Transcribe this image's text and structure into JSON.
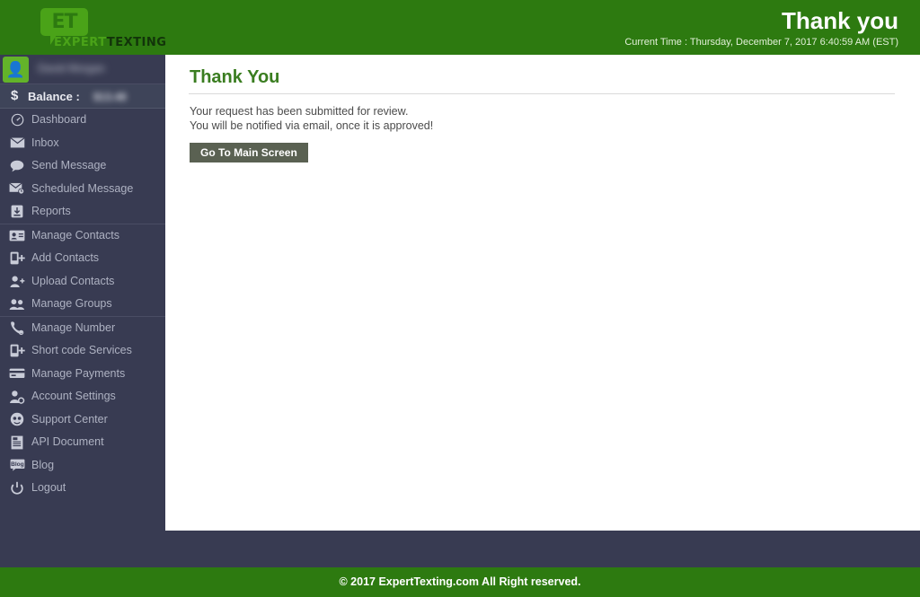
{
  "brand": {
    "logo_mark_text": "ET",
    "logo_word_part1": "EXPERT",
    "logo_word_part2": "TEXTING",
    "logo_icon": "speech-bubble-logo-icon",
    "accent_green": "#2d7a10",
    "logo_green": "#4aa318",
    "sidebar_dark": "#383b52",
    "title_green": "#3a7d20",
    "button_grey": "#5a6152"
  },
  "header": {
    "title": "Thank you",
    "current_time": "Current Time : Thursday, December 7, 2017 6:40:59 AM (EST)"
  },
  "sidebar": {
    "profile": {
      "name": "David Morgan",
      "name_redacted": true,
      "avatar_icon": "user-avatar-icon"
    },
    "balance": {
      "icon": "dollar-icon",
      "label": "Balance :",
      "value": "$13.48",
      "value_redacted": true
    },
    "groups": [
      {
        "items": [
          {
            "label": "Dashboard",
            "icon": "gauge-icon"
          },
          {
            "label": "Inbox",
            "icon": "envelope-icon"
          },
          {
            "label": "Send Message",
            "icon": "speech-bubble-icon"
          },
          {
            "label": "Scheduled Message",
            "icon": "envelope-clock-icon"
          },
          {
            "label": "Reports",
            "icon": "download-box-icon"
          }
        ]
      },
      {
        "items": [
          {
            "label": "Manage Contacts",
            "icon": "contact-card-icon"
          },
          {
            "label": "Add Contacts",
            "icon": "phone-plus-icon"
          },
          {
            "label": "Upload Contacts",
            "icon": "user-plus-icon"
          },
          {
            "label": "Manage Groups",
            "icon": "users-group-icon"
          }
        ]
      },
      {
        "items": [
          {
            "label": "Manage Number",
            "icon": "phone-gear-icon"
          },
          {
            "label": "Short code Services",
            "icon": "mobile-plus-icon"
          },
          {
            "label": "Manage Payments",
            "icon": "credit-card-icon"
          },
          {
            "label": "Account Settings",
            "icon": "user-gear-icon"
          },
          {
            "label": "Support Center",
            "icon": "headset-icon"
          },
          {
            "label": "API Document",
            "icon": "api-document-icon"
          },
          {
            "label": "Blog",
            "icon": "blog-icon"
          },
          {
            "label": "Logout",
            "icon": "power-icon"
          }
        ]
      }
    ]
  },
  "main": {
    "page_title": "Thank You",
    "message_line1": "Your request has been submitted for review.",
    "message_line2": "You will be notified via email, once it is approved!",
    "button_label": "Go To Main Screen"
  },
  "footer": {
    "copyright": "© 2017 ExpertTexting.com All Right reserved."
  }
}
